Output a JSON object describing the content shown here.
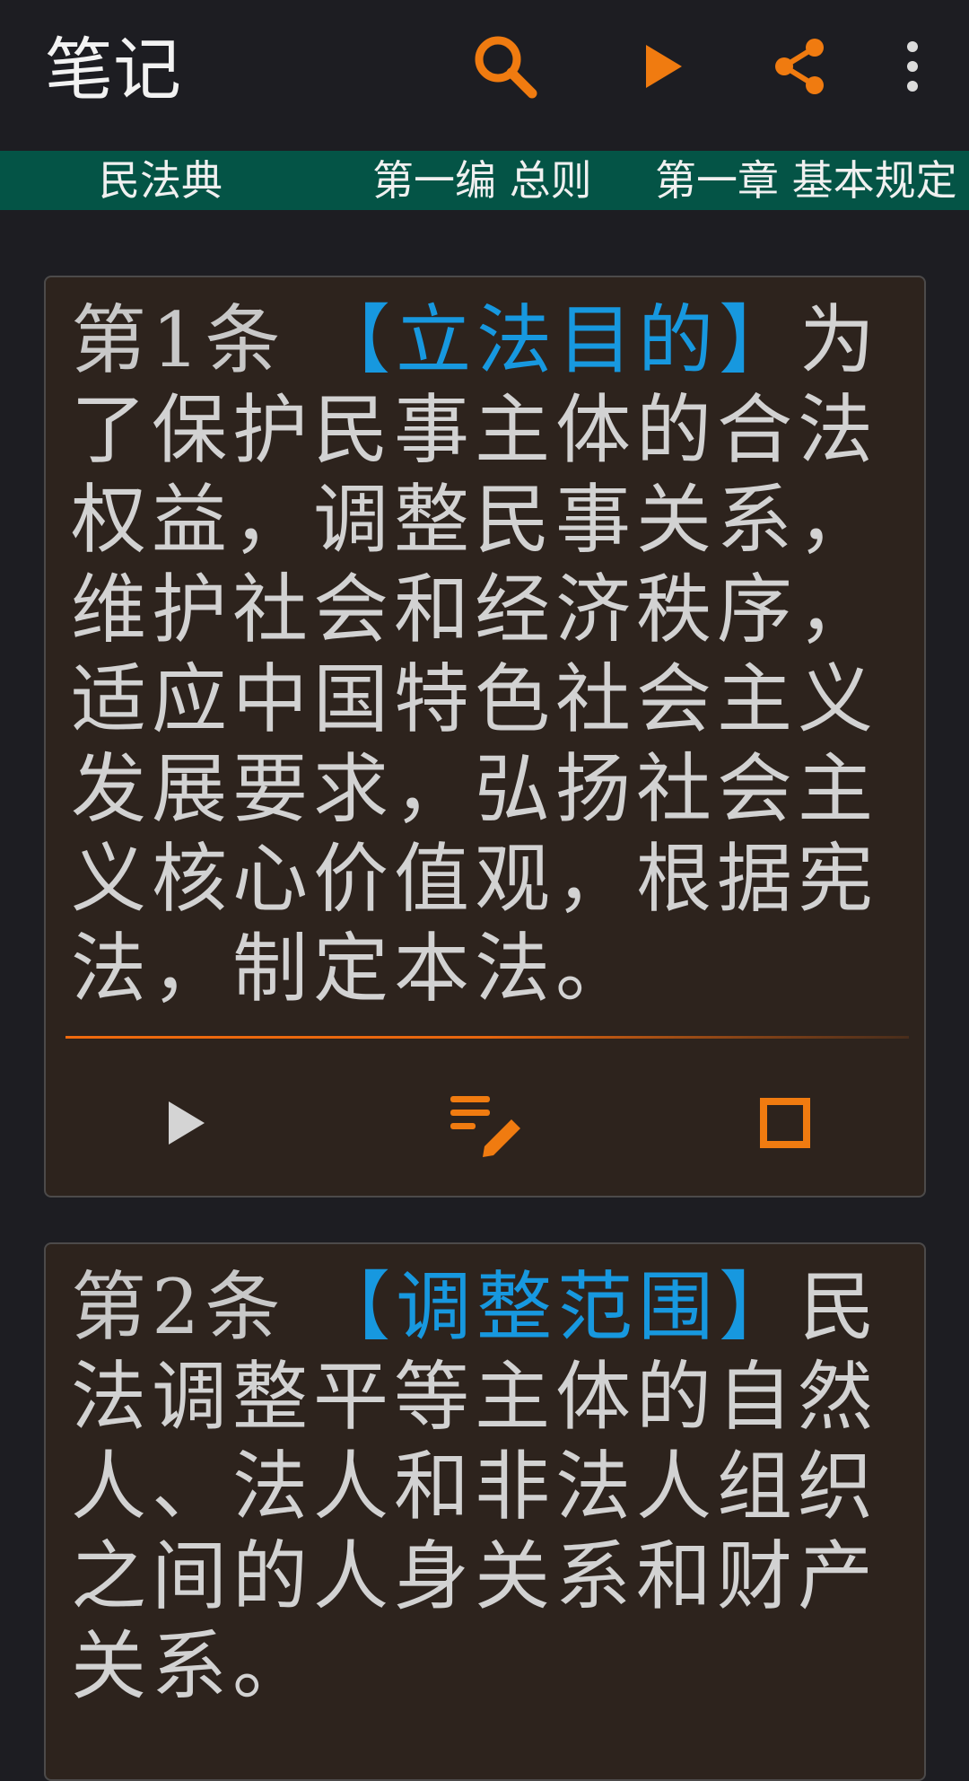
{
  "app": {
    "title": "笔记"
  },
  "toolbar": {
    "icons": [
      "search-icon",
      "play-icon",
      "share-icon",
      "more-vert-icon"
    ]
  },
  "breadcrumb": {
    "items": [
      "民法典",
      "第一编 总则",
      "第一章 基本规定"
    ]
  },
  "colors": {
    "accent": "#f07b10",
    "title_blue": "#1798df",
    "breadcrumb_bg": "#045446",
    "card_bg": "#2d231d",
    "page_bg": "#1d1d22"
  },
  "articles": [
    {
      "number": "第1条",
      "title": "【立法目的】",
      "text": "为了保护民事主体的合法权益，调整民事关系，维护社会和经济秩序，适应中国特色社会主义发展要求，弘扬社会主义核心价值观，根据宪法，制定本法。",
      "actions": [
        "play-icon",
        "edit-note-icon",
        "checkbox-icon"
      ]
    },
    {
      "number": "第2条",
      "title": "【调整范围】",
      "text": "民法调整平等主体的自然人、法人和非法人组织之间的人身关系和财产关系。"
    }
  ]
}
